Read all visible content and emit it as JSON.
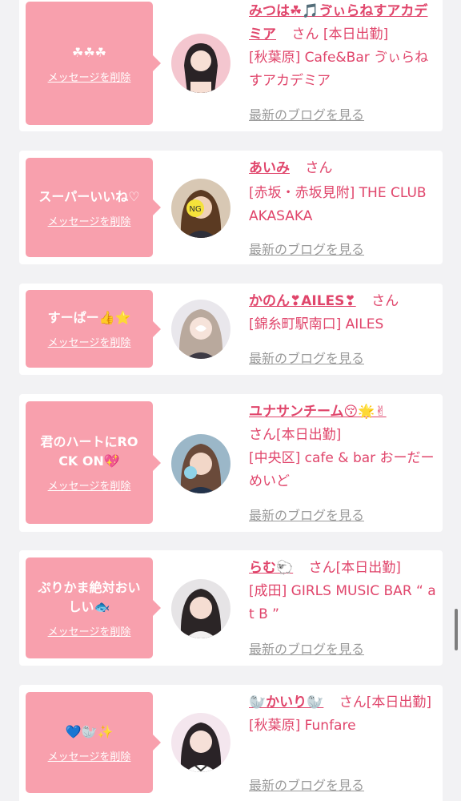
{
  "items": [
    {
      "message": "☘☘☘",
      "delete_label": "メッセージを削除",
      "name": "みつは☘🎵ゔぃらねすアカデミア",
      "suffix": "さん",
      "attendance": "[本日出勤]",
      "shop": "[秋葉原] Cafe&Bar ゔぃらねすアカデミア",
      "blog_label": "最新のブログを見る",
      "avatar": "cast-photo-icon"
    },
    {
      "message": "スーパーいいね♡",
      "delete_label": "メッセージを削除",
      "name": "あいみ",
      "suffix": "さん",
      "attendance": "",
      "shop": "[赤坂・赤坂見附] THE CLUB AKASAKA",
      "blog_label": "最新のブログを見る",
      "avatar": "cast-photo-icon"
    },
    {
      "message": "すーぱー👍⭐",
      "delete_label": "メッセージを削除",
      "name": "かのん❣AILES❣",
      "suffix": "さん",
      "attendance": "",
      "shop": "[錦糸町駅南口] AILES",
      "blog_label": "最新のブログを見る",
      "avatar": "cast-photo-icon"
    },
    {
      "message": "君のハートにROCK ON💖",
      "delete_label": "メッセージを削除",
      "name": "ユナサンチーム😚🌟✌",
      "suffix": "さん",
      "attendance": "[本日出勤]",
      "shop": "[中央区] cafe & bar おーだーめいど",
      "blog_label": "最新のブログを見る",
      "avatar": "cast-photo-icon"
    },
    {
      "message": "ぷりかま絶対おいしい🐟",
      "delete_label": "メッセージを削除",
      "name": "らむ🐑",
      "suffix": "さん",
      "attendance": "[本日出勤]",
      "shop": "[成田] GIRLS MUSIC BAR “ at B ”",
      "blog_label": "最新のブログを見る",
      "avatar": "cast-photo-icon"
    },
    {
      "message": "💙🦭✨",
      "delete_label": "メッセージを削除",
      "name": "🦭かいり🦭",
      "suffix": "さん",
      "attendance": "[本日出勤]",
      "shop": "[秋葉原] Funfare",
      "blog_label": "最新のブログを見る",
      "avatar": "cast-photo-icon"
    }
  ],
  "colors": {
    "accent": "#e0456b",
    "bubble": "#f8a0ad",
    "link_gray": "#9a9a9a",
    "background": "#f2f2f4"
  }
}
